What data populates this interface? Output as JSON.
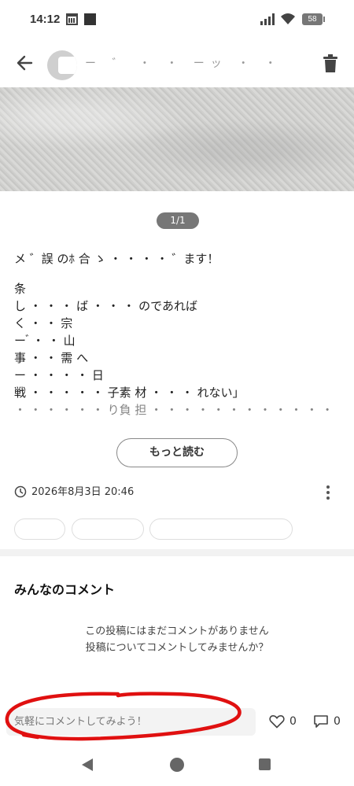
{
  "status_bar": {
    "time": "14:12",
    "battery": "58",
    "icons": [
      "calendar-icon",
      "square-icon",
      "signal-icon",
      "wifi-icon",
      "battery-icon"
    ]
  },
  "header": {
    "user_name": "ー ゛  ・ ・  ーッ ・ ・ ・ ・ ・ ﾕr",
    "icons": [
      "back-arrow-icon",
      "trash-icon"
    ]
  },
  "post": {
    "pager": "1/1",
    "body_lines": [
      "メ ゛誤 のﾎ 合 ゝ ・ ・  ・ ・  ゛ます！",
      "条",
      "し ・  ・ ・ ば ・  ・ ・  のであれば",
      "く ・ ・ 宗",
      "ー  ゙ ・ ・ 山",
      "事 ・ ・ 需 へ",
      "ー ・ ・ ・ ・ 日",
      "戦 ・ ・ ・ ・ ・ 子素 材 ・ ・ ・ れない」",
      "・ ・ ・ ・ ・ ・  り負 担 ・ ・ ・ ・ ・ ・ ・  ・ ・ ・ ・ ・ ・ して"
    ],
    "more_label": "もっと読む",
    "date": "2026年8月3日 20:46"
  },
  "comments": {
    "title": "みんなのコメント",
    "empty_line1": "この投稿にはまだコメントがありません",
    "empty_line2": "投稿についてコメントしてみませんか？",
    "input_placeholder": "気軽にコメントしてみよう！",
    "like_count": "0",
    "comment_count": "0"
  },
  "colors": {
    "annotation_stroke": "#e01010",
    "pager_bg": "#777777"
  }
}
